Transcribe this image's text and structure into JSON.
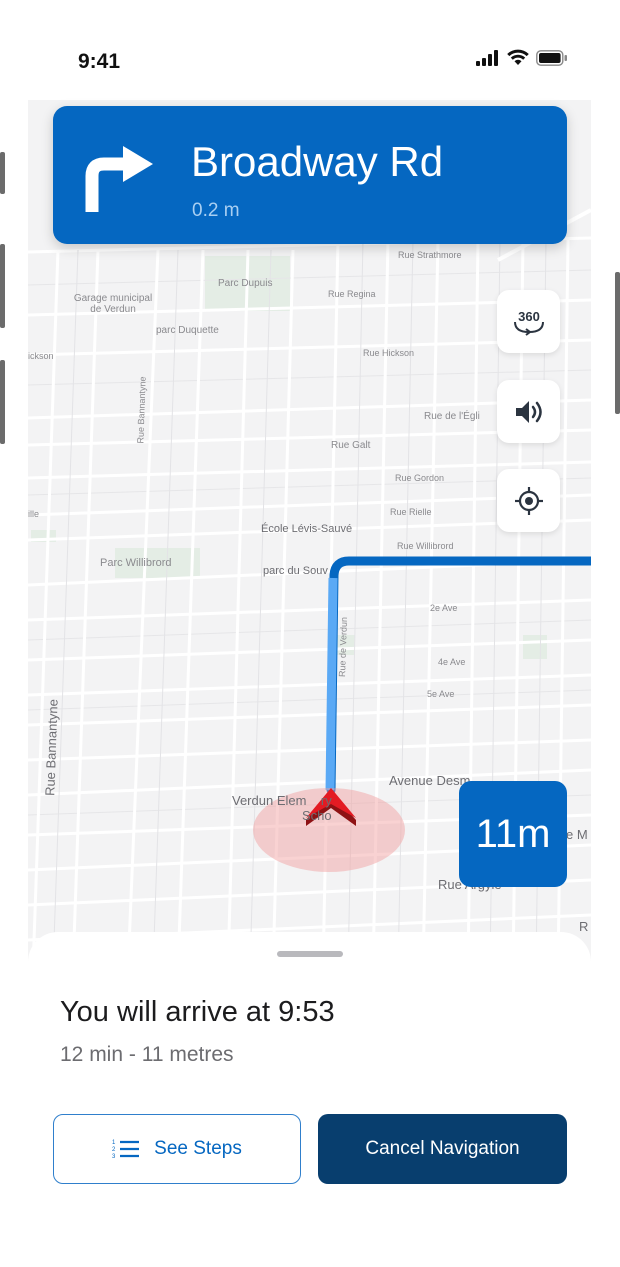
{
  "status_bar": {
    "time": "9:41"
  },
  "navigation": {
    "street": "Broadway Rd",
    "distance": "0.2 m",
    "turn_icon": "turn-right-arrow-icon"
  },
  "map": {
    "labels": {
      "rue_strathmore": "Rue Strathmore",
      "garage": "Garage municipal de Verdun",
      "parc_dupuis": "Parc Dupuis",
      "rue_regina": "Rue Regina",
      "parc_duquette": "parc Duquette",
      "rue_hickson_left": "ickson",
      "rue_hickson": "Rue Hickson",
      "rue_de_l_eglise": "Rue de l'Égli",
      "rue_galt": "Rue Galt",
      "rue_gordon": "Rue Gordon",
      "rue_rielle": "Rue Rielle",
      "ille": "ille",
      "ecole": "École Lévis-Sauvé",
      "rue_willibrord": "Rue Willibrord",
      "parc_willibrord": "Parc Willibrord",
      "parc_du_souvenir": "parc du Souv",
      "ave_2": "2e Ave",
      "ave_4": "4e Ave",
      "ave_5": "5e Ave",
      "rue_bannantyne_big": "Rue Bannantyne",
      "rue_bannantyne_small": "Rue Bannantyne",
      "ave_desmarchais": "Avenue Desm",
      "verdun_school": "Verdun Elem    ry",
      "verdun_school_2": "Scho",
      "rue_argyle": "Rue Argyle",
      "rue_de_verdun": "Rue de Verdun",
      "rue_m": "e M",
      "rue_r": "R"
    }
  },
  "controls": {
    "view_360": "360",
    "sound_icon": "speaker-icon",
    "recenter_icon": "locate-icon"
  },
  "remaining_distance": "11m",
  "sheet": {
    "arrive": "You will arrive at 9:53",
    "summary": "12 min - 11 metres",
    "see_steps": "See Steps",
    "cancel": "Cancel Navigation"
  },
  "colors": {
    "primary": "#0567c1",
    "dark": "#083e6e",
    "route": "#5aa9f5"
  }
}
